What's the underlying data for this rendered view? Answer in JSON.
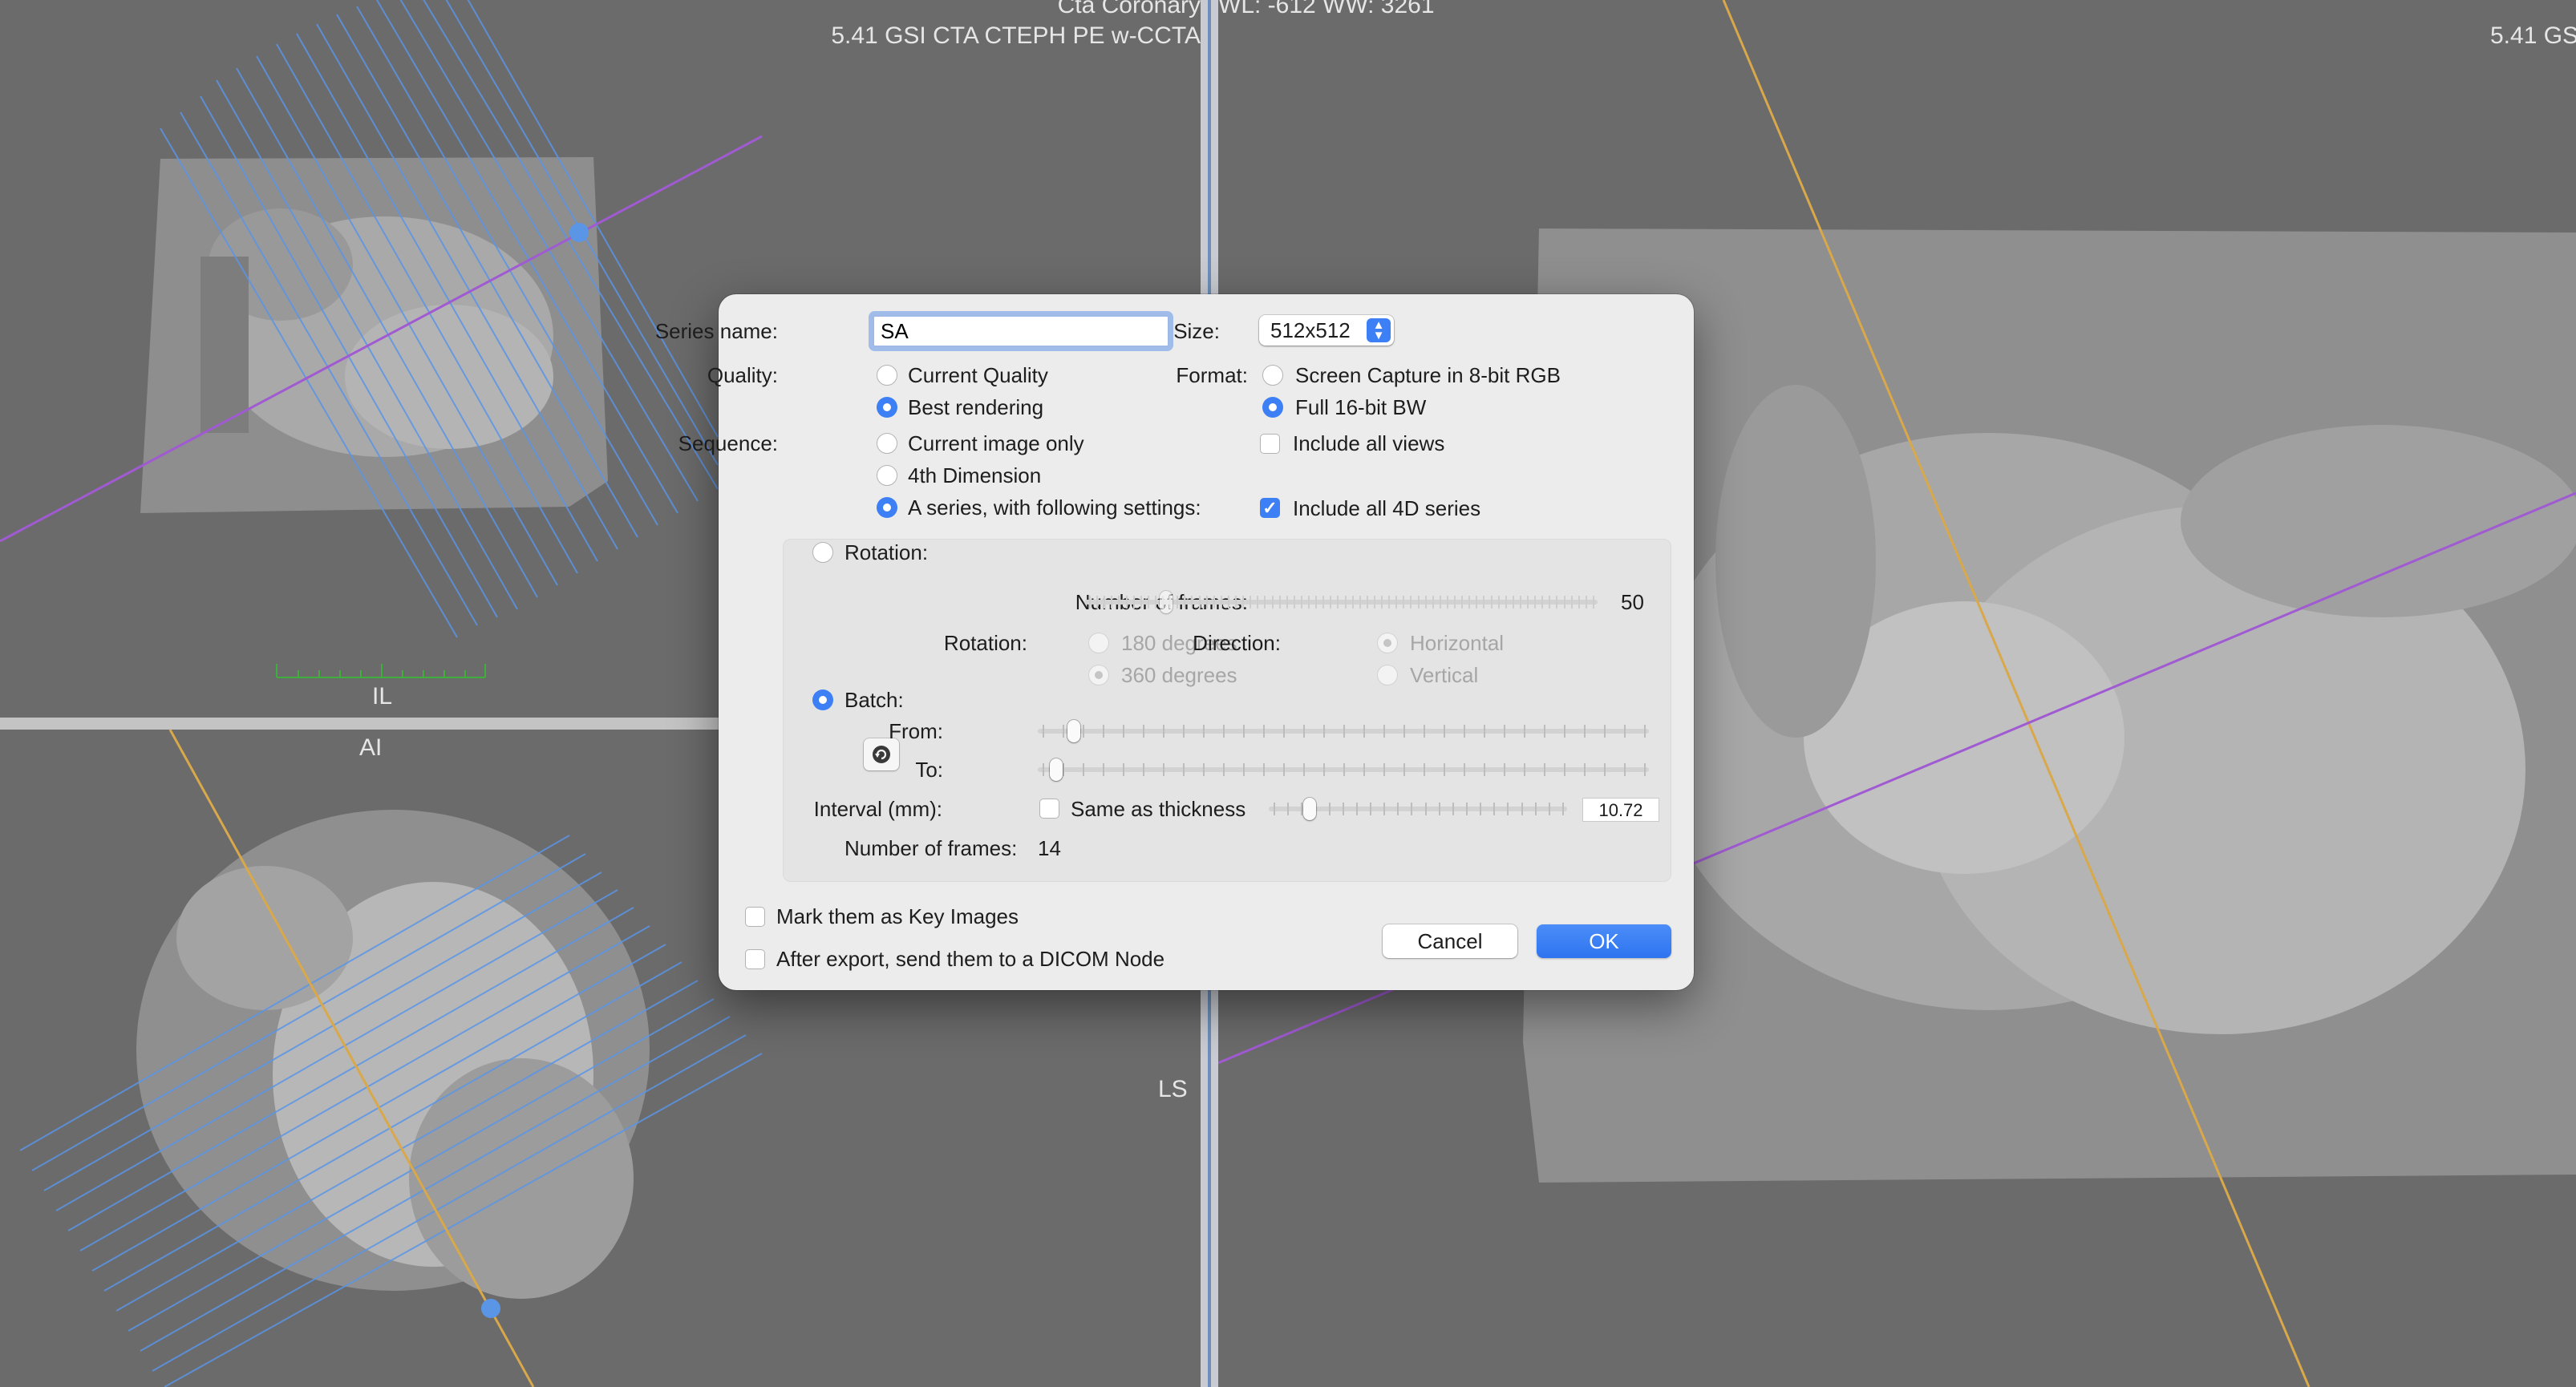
{
  "viewer": {
    "top_center_line1": "Cta Coronary",
    "top_center_line2": "5.41 GSI CTA CTEPH PE w-CCTA",
    "window_level": "WL: -612 WW: 3261",
    "right_series": "5.41 GS",
    "orientation_il": "IL",
    "orientation_ai": "AI",
    "orientation_ls": "LS"
  },
  "dialog": {
    "series_name_label": "Series name:",
    "series_name_value": "SA",
    "size_label": "Size:",
    "size_value": "512x512",
    "quality_label": "Quality:",
    "quality_options": [
      "Current Quality",
      "Best rendering"
    ],
    "quality_selected": "Best rendering",
    "format_label": "Format:",
    "format_options": [
      "Screen Capture in 8-bit RGB",
      "Full 16-bit BW"
    ],
    "format_selected": "Full 16-bit BW",
    "sequence_label": "Sequence:",
    "sequence_options": [
      "Current image only",
      "4th Dimension",
      "A series, with following settings:"
    ],
    "sequence_selected": "A series, with following settings:",
    "include_all_views": {
      "label": "Include all views",
      "checked": false
    },
    "include_all_4d": {
      "label": "Include all 4D series",
      "checked": true
    },
    "rotation": {
      "radio_label": "Rotation:",
      "frames_label": "Number of frames:",
      "frames_value": "50",
      "frames_slider_fraction": 0.15,
      "rotation_label": "Rotation:",
      "rotation_options": [
        "180 degrees",
        "360 degrees"
      ],
      "rotation_selected": "360 degrees",
      "direction_label": "Direction:",
      "direction_options": [
        "Horizontal",
        "Vertical"
      ],
      "direction_selected": "Horizontal"
    },
    "batch": {
      "radio_label": "Batch:",
      "from_label": "From:",
      "to_label": "To:",
      "from_fraction": 0.05,
      "to_fraction": 0.02,
      "interval_label": "Interval (mm):",
      "same_as_thickness": {
        "label": "Same as thickness",
        "checked": false
      },
      "interval_value": "10.72",
      "interval_fraction": 0.12,
      "frames_label": "Number of frames:",
      "frames_value": "14"
    },
    "mark_key_images": {
      "label": "Mark them as Key Images",
      "checked": false
    },
    "send_dicom": {
      "label": "After export, send them to a DICOM Node",
      "checked": false
    },
    "cancel_label": "Cancel",
    "ok_label": "OK"
  }
}
